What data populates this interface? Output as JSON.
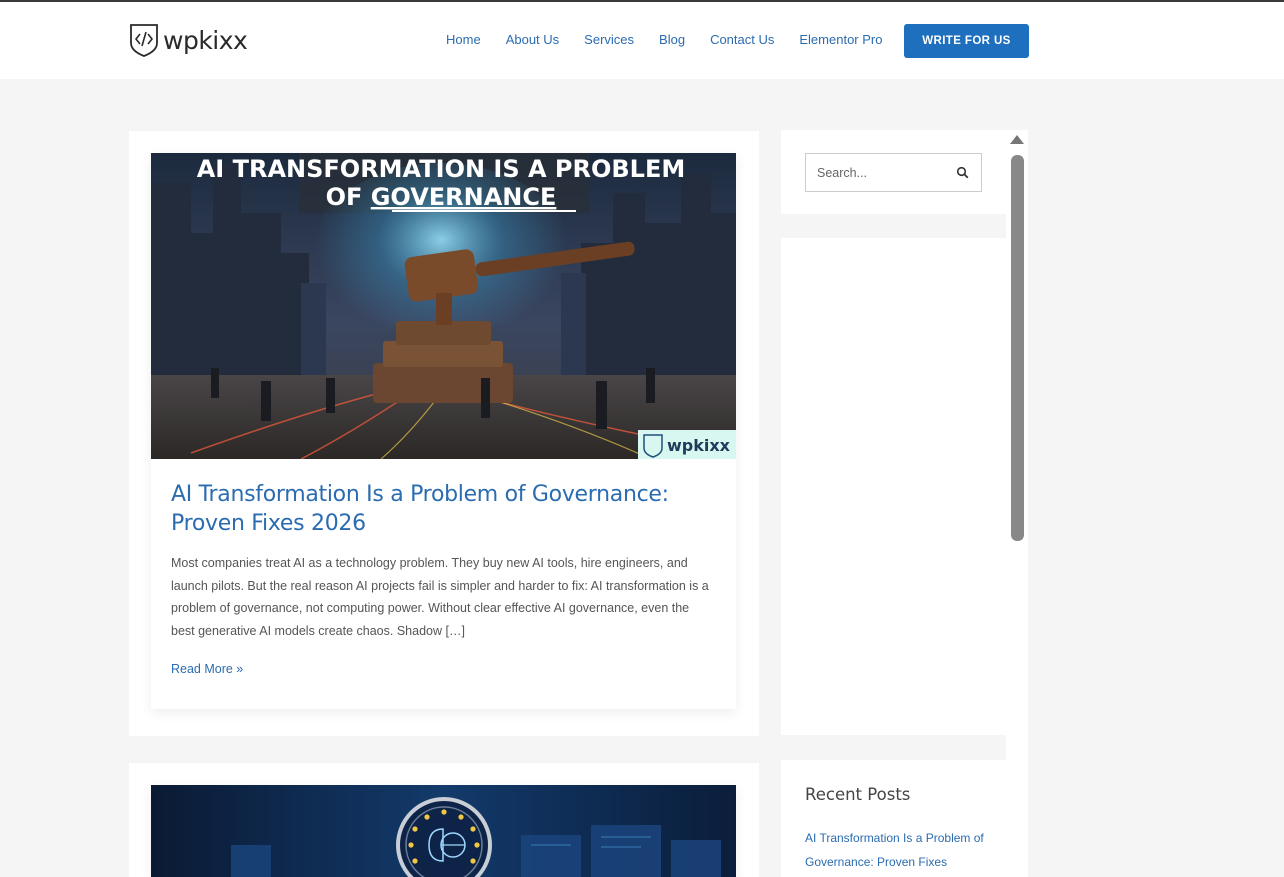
{
  "brand": {
    "name": "wpkixx",
    "icon": "code-shield-icon"
  },
  "nav": {
    "items": [
      "Home",
      "About Us",
      "Services",
      "Blog",
      "Contact Us",
      "Elementor Pro"
    ],
    "cta": "WRITE FOR US"
  },
  "posts": [
    {
      "image": {
        "headline_line1": "AI TRANSFORMATION IS A PROBLEM",
        "headline_line2_prefix": "OF ",
        "headline_line2_emph": "GOVERNANCE",
        "watermark": "wpkixx"
      },
      "title": "AI Transformation Is a Problem of Governance: Proven Fixes 2026",
      "excerpt": "Most companies treat AI as a technology problem. They buy new AI tools, hire engineers, and launch pilots. But the real reason AI projects fail is simpler and harder to fix: AI transformation is a problem of governance, not computing power. Without clear effective AI governance, even the best generative AI models create chaos. Shadow […]",
      "read_more": "Read More »"
    },
    {
      "image": {
        "icon": "eu-brain-globe-icon"
      }
    }
  ],
  "sidebar": {
    "search": {
      "placeholder": "Search..."
    },
    "recent_posts": {
      "title": "Recent Posts",
      "items": [
        "AI Transformation Is a Problem of Governance: Proven Fixes"
      ]
    }
  },
  "colors": {
    "accent": "#2b6cb0",
    "button": "#1f6fbf",
    "background": "#f5f5f5"
  }
}
